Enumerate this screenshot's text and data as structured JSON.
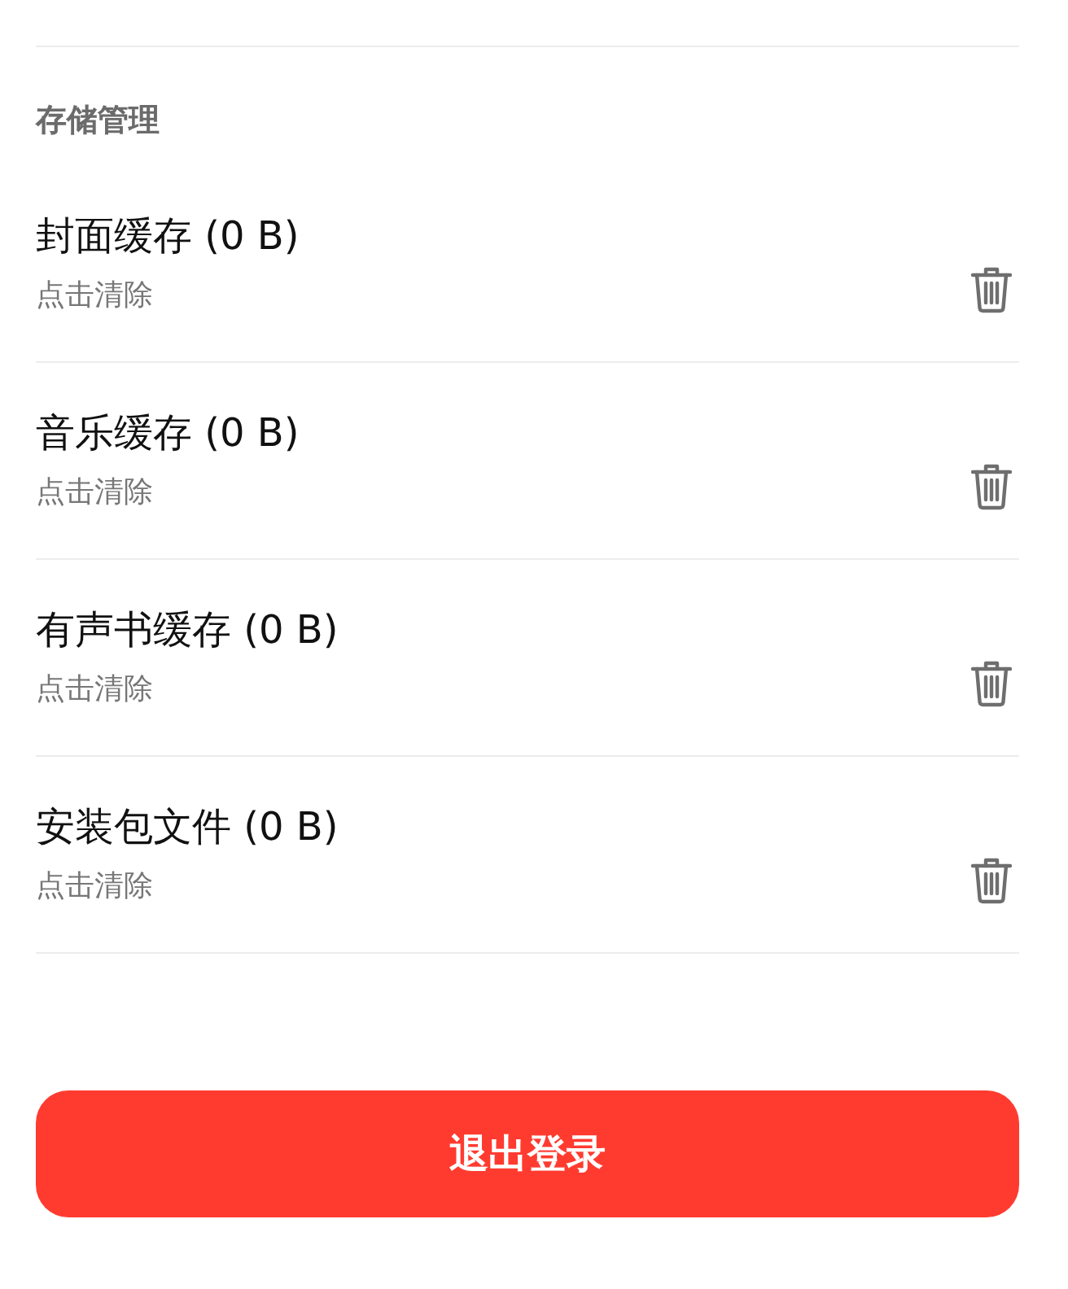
{
  "section": {
    "title": "存储管理"
  },
  "items": [
    {
      "title": "封面缓存 (0 B)",
      "subtitle": "点击清除"
    },
    {
      "title": "音乐缓存 (0 B)",
      "subtitle": "点击清除"
    },
    {
      "title": "有声书缓存 (0 B)",
      "subtitle": "点击清除"
    },
    {
      "title": "安装包文件 (0 B)",
      "subtitle": "点击清除"
    }
  ],
  "logout_button": "退出登录"
}
